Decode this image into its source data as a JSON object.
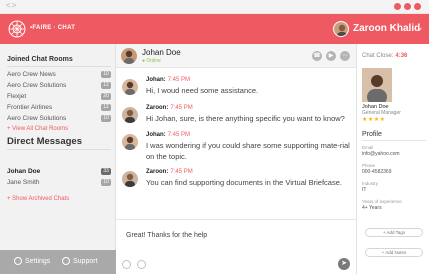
{
  "window": {
    "nav": "<>",
    "dot_colors": [
      "#ef5a62",
      "#ef5a62",
      "#ef5a62"
    ]
  },
  "header": {
    "brand": "•FAIRE · CHAT",
    "user_name": "Zaroon Khalid",
    "chevron": "⌄",
    "accent": "#ef5a62"
  },
  "sidebar": {
    "joined_title": "Joined Chat Rooms",
    "rooms": [
      {
        "label": "Aero Crew News",
        "badge": "10"
      },
      {
        "label": "Aero Crew Solutions",
        "badge": "12"
      },
      {
        "label": "Flexjet",
        "badge": "20"
      },
      {
        "label": "Frontier Airlines",
        "badge": "12"
      },
      {
        "label": "Aero Crew Solutions",
        "badge": "10"
      }
    ],
    "view_all": "+ View All Chat Rooms",
    "dm_title": "Direct Messages",
    "dms": [
      {
        "label": "Johan Doe",
        "badge": "33"
      },
      {
        "label": "Jane Smith",
        "badge": "10"
      }
    ],
    "show_archived": "+ Show Archived Chats",
    "settings": "Settings",
    "support": "Support"
  },
  "chat": {
    "name": "Johan Doe",
    "status": "● Online",
    "messages": [
      {
        "who": "Johan:",
        "time": "7:45 PM",
        "text": "Hi, I woud need some assistance."
      },
      {
        "who": "Zaroon:",
        "time": "7:45 PM",
        "text": "Hi Johan, sure, is there anything specific you want to know?"
      },
      {
        "who": "Johan:",
        "time": "7:45 PM",
        "text": "I was wondering if you could share some supporting mate-rial on the topic."
      },
      {
        "who": "Zaroon:",
        "time": "7:45 PM",
        "text": "You can find supporting documents in the Virtual Briefcase."
      }
    ],
    "composer_text": "Great! Thanks for the help"
  },
  "profile": {
    "chat_close": "Chat Close:",
    "timer": "4:36",
    "name": "Johan Doe",
    "role": "General Manager",
    "stars": "★★★★",
    "title": "Profile",
    "fields": [
      {
        "label": "Email",
        "value": "info@yahoo.com"
      },
      {
        "label": "Phone",
        "value": "000-4582369"
      },
      {
        "label": "Industry",
        "value": "IT"
      },
      {
        "label": "Years of experience",
        "value": "4+ Years"
      }
    ],
    "add_tags": "+ Add Tags",
    "add_notes": "+ Add Notes"
  }
}
